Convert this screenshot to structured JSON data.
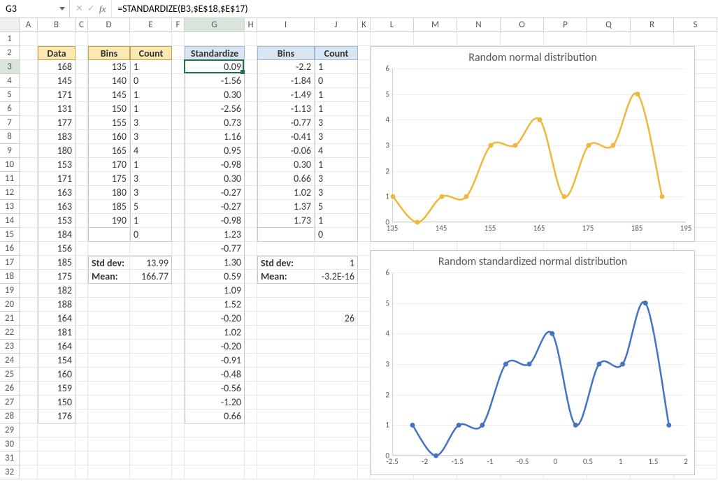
{
  "formula_bar": {
    "cell_ref": "G3",
    "formula": "=STANDARDIZE(B3,$E$18,$E$17)"
  },
  "columns": [
    {
      "l": "A",
      "w": 26
    },
    {
      "l": "B",
      "w": 54
    },
    {
      "l": "C",
      "w": 18
    },
    {
      "l": "D",
      "w": 60
    },
    {
      "l": "E",
      "w": 60
    },
    {
      "l": "F",
      "w": 18
    },
    {
      "l": "G",
      "w": 86
    },
    {
      "l": "H",
      "w": 18
    },
    {
      "l": "I",
      "w": 82
    },
    {
      "l": "J",
      "w": 62
    },
    {
      "l": "K",
      "w": 18
    },
    {
      "l": "L",
      "w": 62
    },
    {
      "l": "M",
      "w": 62
    },
    {
      "l": "N",
      "w": 62
    },
    {
      "l": "O",
      "w": 62
    },
    {
      "l": "P",
      "w": 62
    },
    {
      "l": "Q",
      "w": 62
    },
    {
      "l": "R",
      "w": 62
    },
    {
      "l": "S",
      "w": 62
    }
  ],
  "row_count": 32,
  "active": {
    "col": 6,
    "row": 3
  },
  "headers": {
    "data": "Data",
    "bins": "Bins",
    "count": "Count",
    "std": "Standardize"
  },
  "labels": {
    "stddev": "Std dev:",
    "mean": "Mean:"
  },
  "stats1": {
    "stddev": "13.99",
    "mean": "166.77"
  },
  "stats2": {
    "stddev": "1",
    "mean": "-3.2E-16"
  },
  "extra": {
    "J21": "26"
  },
  "data_col": [
    "168",
    "145",
    "171",
    "131",
    "177",
    "183",
    "180",
    "153",
    "171",
    "163",
    "163",
    "153",
    "184",
    "156",
    "185",
    "175",
    "182",
    "188",
    "164",
    "181",
    "164",
    "154",
    "160",
    "159",
    "150",
    "176"
  ],
  "bins1": [
    "135",
    "140",
    "145",
    "150",
    "155",
    "160",
    "165",
    "170",
    "175",
    "180",
    "185",
    "190"
  ],
  "count1": [
    "1",
    "0",
    "1",
    "1",
    "3",
    "3",
    "4",
    "1",
    "3",
    "3",
    "5",
    "1",
    "0"
  ],
  "standardize": [
    "0.09",
    "-1.56",
    "0.30",
    "-2.56",
    "0.73",
    "1.16",
    "0.95",
    "-0.98",
    "0.30",
    "-0.27",
    "-0.27",
    "-0.98",
    "1.23",
    "-0.77",
    "1.30",
    "0.59",
    "1.09",
    "1.52",
    "-0.20",
    "1.02",
    "-0.20",
    "-0.91",
    "-0.48",
    "-0.56",
    "-1.20",
    "0.66"
  ],
  "bins2": [
    "-2.2",
    "-1.84",
    "-1.49",
    "-1.13",
    "-0.77",
    "-0.41",
    "-0.06",
    "0.30",
    "0.66",
    "1.02",
    "1.37",
    "1.73"
  ],
  "count2": [
    "1",
    "0",
    "1",
    "1",
    "3",
    "3",
    "4",
    "1",
    "3",
    "3",
    "5",
    "1",
    "0"
  ],
  "chart_data": [
    {
      "type": "line",
      "title": "Random normal distribution",
      "x": [
        135,
        140,
        145,
        150,
        155,
        160,
        165,
        170,
        175,
        180,
        185,
        190
      ],
      "y": [
        1,
        0,
        1,
        1,
        3,
        3,
        4,
        1,
        3,
        3,
        5,
        1
      ],
      "xlim": [
        135,
        195
      ],
      "ylim": [
        0,
        6
      ],
      "xticks": [
        135,
        145,
        155,
        165,
        175,
        185,
        195
      ],
      "yticks": [
        0,
        1,
        2,
        3,
        4,
        5,
        6
      ],
      "color": "#edb83b"
    },
    {
      "type": "line",
      "title": "Random standardized normal distribution",
      "x": [
        -2.2,
        -1.84,
        -1.49,
        -1.13,
        -0.77,
        -0.41,
        -0.06,
        0.3,
        0.66,
        1.02,
        1.37,
        1.73
      ],
      "y": [
        1,
        0,
        1,
        1,
        3,
        3,
        4,
        1,
        3,
        3,
        5,
        1
      ],
      "xlim": [
        -2.5,
        2
      ],
      "ylim": [
        0,
        6
      ],
      "xticks": [
        -2.5,
        -2,
        -1.5,
        -1,
        -0.5,
        0,
        0.5,
        1,
        1.5,
        2
      ],
      "yticks": [
        0,
        1,
        2,
        3,
        4,
        5,
        6
      ],
      "color": "#4472c4"
    }
  ]
}
